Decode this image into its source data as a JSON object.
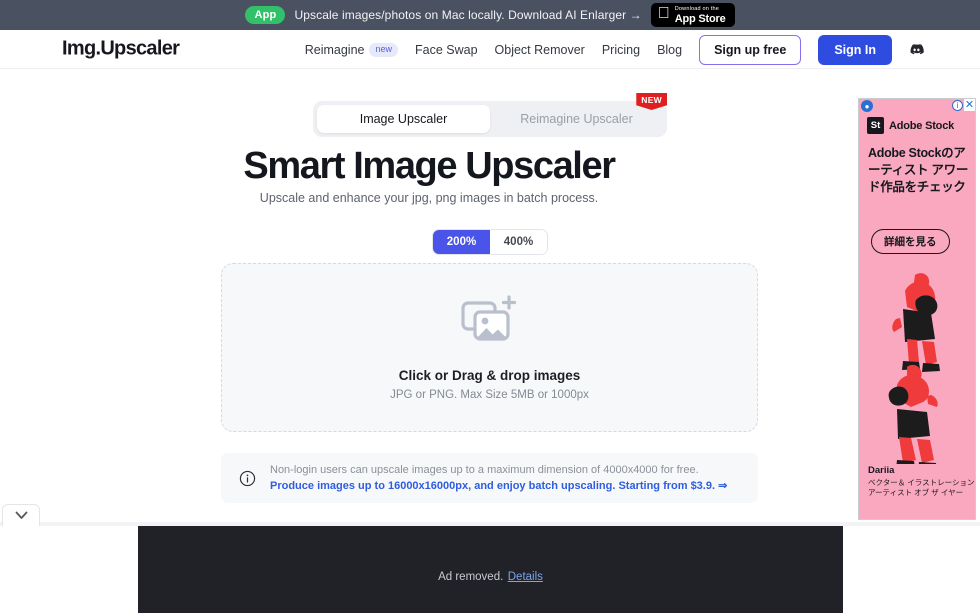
{
  "promo": {
    "pill": "App",
    "text": "Upscale images/photos on Mac locally. Download AI Enlarger →",
    "appstore_small": "Download on the",
    "appstore_big": "App Store",
    "apple_icon": "apple-icon"
  },
  "header": {
    "logo": "Img.Upscaler",
    "nav": [
      {
        "label": "Reimagine",
        "badge": "new"
      },
      {
        "label": "Face Swap"
      },
      {
        "label": "Object Remover"
      },
      {
        "label": "Pricing"
      },
      {
        "label": "Blog"
      }
    ],
    "signup_label": "Sign up free",
    "signin_label": "Sign In",
    "discord_icon": "discord-icon"
  },
  "main": {
    "tabs": [
      {
        "label": "Image Upscaler",
        "active": true
      },
      {
        "label": "Reimagine Upscaler",
        "active": false,
        "badge": "NEW"
      }
    ],
    "title": "Smart Image Upscaler",
    "subtitle": "Upscale and enhance your jpg, png images in batch process.",
    "scale_options": [
      {
        "label": "200%",
        "selected": true
      },
      {
        "label": "400%",
        "selected": false
      }
    ],
    "dropzone": {
      "icon": "add-photo-icon",
      "title": "Click or Drag & drop images",
      "subtitle": "JPG or PNG. Max Size 5MB or 1000px"
    },
    "info": {
      "icon": "info-circle-icon",
      "line1": "Non-login users can upscale images up to a maximum dimension of 4000x4000 for free.",
      "line2": "Produce images up to 16000x16000px, and enjoy batch upscaling. Starting from $3.9. ⇒"
    }
  },
  "ad": {
    "adchoices_icon": "adchoices-icon",
    "info_icon": "ad-info-icon",
    "close_icon": "close-icon",
    "logo_mark": "St",
    "brand": "Adobe Stock",
    "headline": "Adobe Stockのアーティスト アワード作品をチェック",
    "cta": "詳細を見る",
    "credit_name": "Dariia",
    "credit_role": "ベクター＆ イラストレーション アーティスト オブ ザ イヤー",
    "bg_color": "#f9a8c0",
    "art_primary": "#ef3b3b",
    "art_dark": "#1c1c1c"
  },
  "bottom": {
    "ad_removed_text": "Ad removed.",
    "details_link": "Details",
    "collapse_icon": "chevron-down-icon"
  },
  "colors": {
    "accent_blue": "#2f4ce0",
    "toggle_active": "#4a54e8",
    "promo_green": "#32c06a",
    "badge_red": "#e02020"
  }
}
